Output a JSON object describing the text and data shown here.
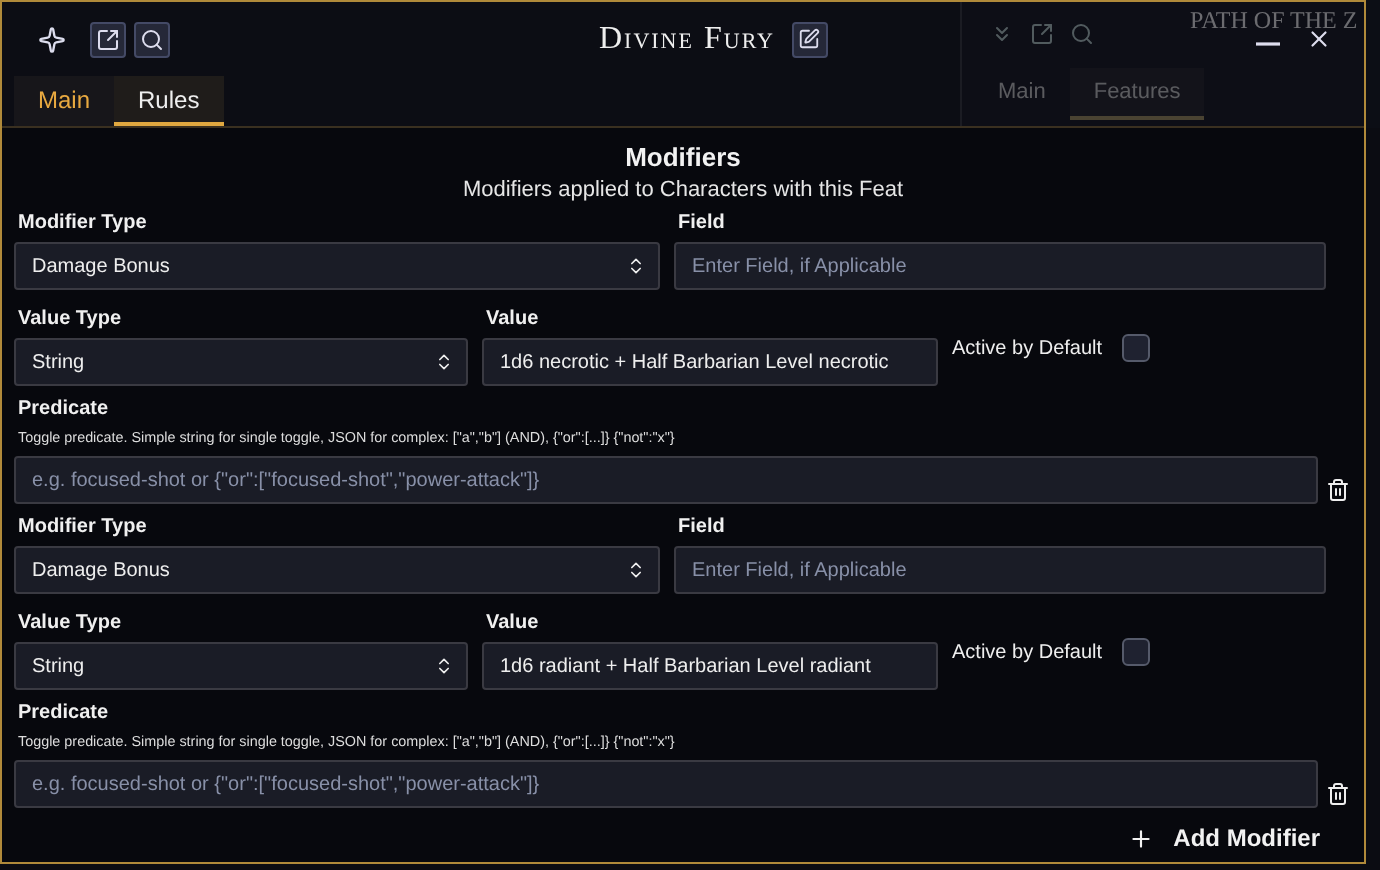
{
  "background_window": {
    "title": "PATH OF THE Z",
    "tabs": [
      {
        "label": "Main",
        "selected": false
      },
      {
        "label": "Features",
        "selected": true
      }
    ]
  },
  "window": {
    "title": "Divine Fury"
  },
  "tabs": [
    {
      "label": "Main",
      "selected": false
    },
    {
      "label": "Rules",
      "selected": true
    }
  ],
  "section": {
    "title": "Modifiers",
    "subtitle": "Modifiers applied to Characters with this Feat"
  },
  "modifiers": [
    {
      "modifier_type_label": "Modifier Type",
      "modifier_type": "Damage Bonus",
      "field_label": "Field",
      "field_placeholder": "Enter Field, if Applicable",
      "value_type_label": "Value Type",
      "value_type": "String",
      "value_label": "Value",
      "value": "1d6 necrotic + Half Barbarian Level necrotic",
      "active_label": "Active by Default",
      "active": false,
      "predicate_label": "Predicate",
      "predicate_hint": "Toggle predicate. Simple string for single toggle, JSON for complex: [\"a\",\"b\"] (AND), {\"or\":[...]} {\"not\":\"x\"}",
      "predicate_placeholder": "e.g. focused-shot or {\"or\":[\"focused-shot\",\"power-attack\"]}"
    },
    {
      "modifier_type_label": "Modifier Type",
      "modifier_type": "Damage Bonus",
      "field_label": "Field",
      "field_placeholder": "Enter Field, if Applicable",
      "value_type_label": "Value Type",
      "value_type": "String",
      "value_label": "Value",
      "value": "1d6 radiant + Half Barbarian Level radiant",
      "active_label": "Active by Default",
      "active": false,
      "predicate_label": "Predicate",
      "predicate_hint": "Toggle predicate. Simple string for single toggle, JSON for complex: [\"a\",\"b\"] (AND), {\"or\":[...]} {\"not\":\"x\"}",
      "predicate_placeholder": "e.g. focused-shot or {\"or\":[\"focused-shot\",\"power-attack\"]}"
    }
  ],
  "add_button": {
    "label": "Add Modifier"
  }
}
